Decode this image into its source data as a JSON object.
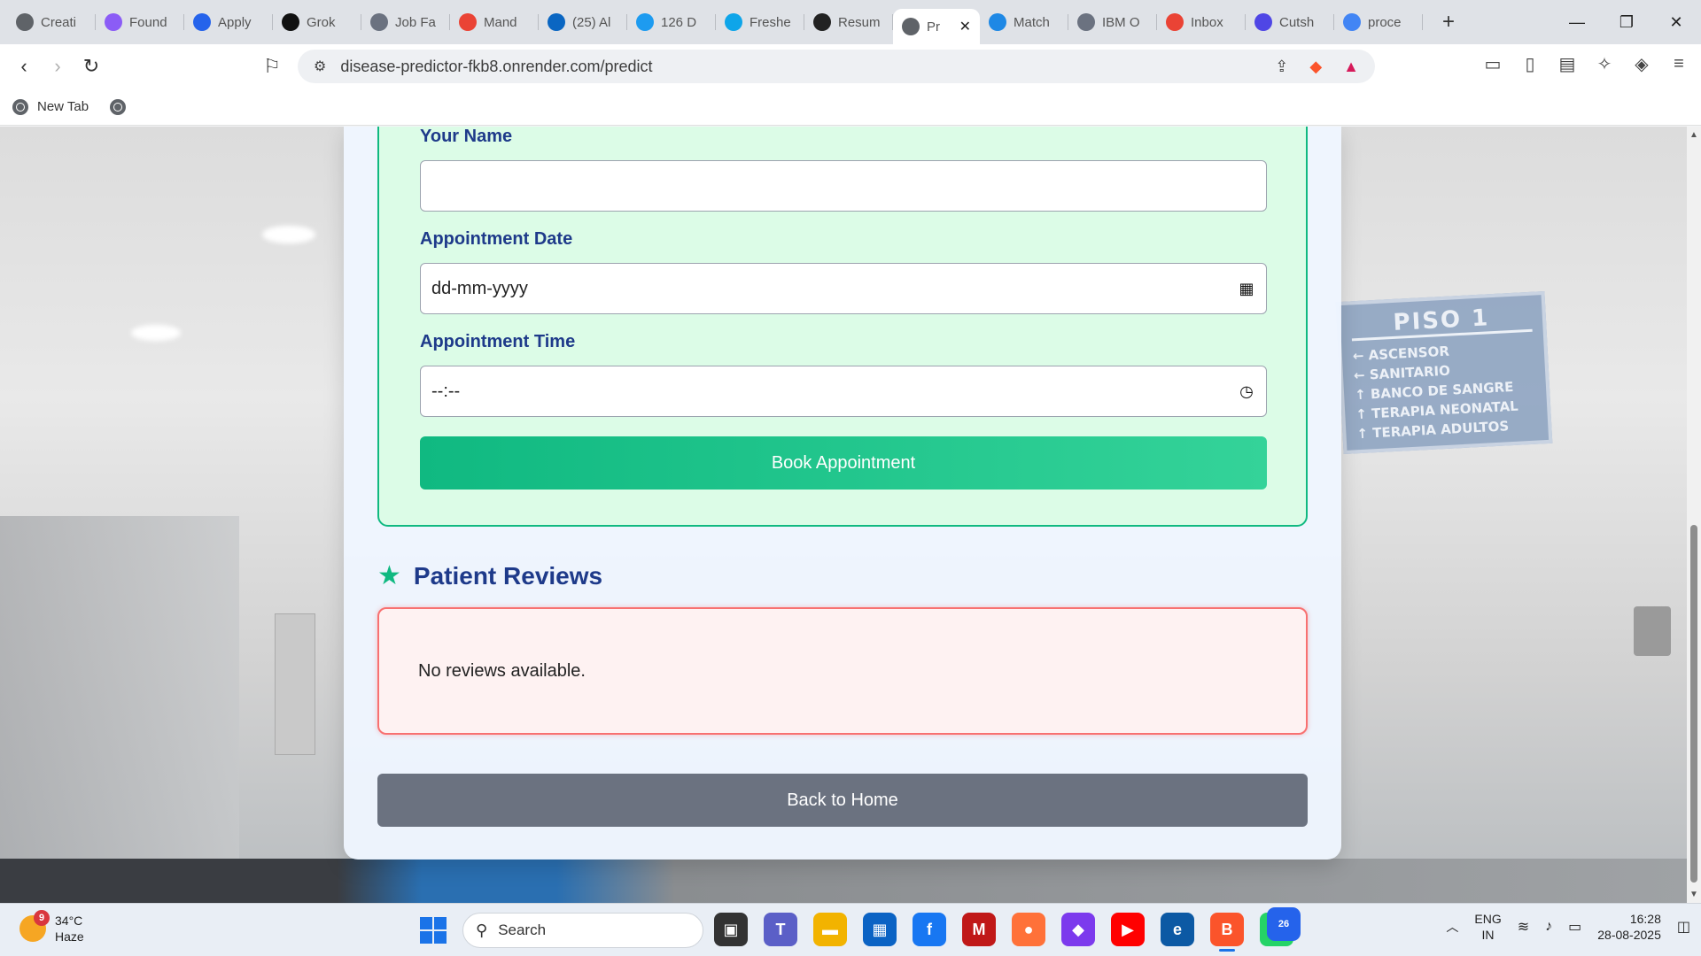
{
  "browser": {
    "tabs": [
      {
        "title": "Creati",
        "icon": "openai-icon",
        "color": "#5f6368"
      },
      {
        "title": "Found",
        "icon": "gemini-icon",
        "color": "#8b5cf6"
      },
      {
        "title": "Apply",
        "icon": "apply-icon",
        "color": "#2563eb"
      },
      {
        "title": "Grok",
        "icon": "grok-icon",
        "color": "#111111"
      },
      {
        "title": "Job Fa",
        "icon": "jobfair-icon",
        "color": "#6b7280"
      },
      {
        "title": "Mand",
        "icon": "gmail-icon",
        "color": "#ea4335"
      },
      {
        "title": "(25) Al",
        "icon": "linkedin-icon",
        "color": "#0a66c2"
      },
      {
        "title": "126 D",
        "icon": "s-icon",
        "color": "#1d9bf0"
      },
      {
        "title": "Freshe",
        "icon": "is-icon",
        "color": "#0ea5e9"
      },
      {
        "title": "Resum",
        "icon": "openai-icon",
        "color": "#222222"
      },
      {
        "title": "Pr",
        "icon": "globe-icon",
        "color": "#5f6368",
        "active": true
      },
      {
        "title": "Match",
        "icon": "match-icon",
        "color": "#1e88e5"
      },
      {
        "title": "IBM O",
        "icon": "ibm-icon",
        "color": "#6b7280"
      },
      {
        "title": "Inbox",
        "icon": "gmail-icon",
        "color": "#ea4335"
      },
      {
        "title": "Cutsh",
        "icon": "cutshort-icon",
        "color": "#4f46e5"
      },
      {
        "title": "proce",
        "icon": "google-icon",
        "color": "#4285f4"
      }
    ],
    "url": "disease-predictor-fkb8.onrender.com/predict",
    "bookmarks": [
      {
        "label": "New Tab"
      }
    ]
  },
  "form": {
    "name_label": "Your Name",
    "name_value": "",
    "date_label": "Appointment Date",
    "date_placeholder": "dd-mm-yyyy",
    "time_label": "Appointment Time",
    "time_placeholder": "--:--",
    "book_button": "Book Appointment"
  },
  "reviews": {
    "heading": "Patient Reviews",
    "empty_text": "No reviews available."
  },
  "home_button": "Back to Home",
  "background_sign": {
    "heading": "PISO 1",
    "lines": [
      "ASCENSOR",
      "SANITARIO",
      "BANCO DE SANGRE",
      "TERAPIA NEONATAL",
      "TERAPIA ADULTOS"
    ]
  },
  "taskbar": {
    "weather_temp": "34°C",
    "weather_desc": "Haze",
    "weather_badge": "9",
    "search_label": "Search",
    "apps": [
      {
        "name": "task-view",
        "color": "#333333",
        "glyph": "▣"
      },
      {
        "name": "teams",
        "color": "#5b5fc7",
        "glyph": "T"
      },
      {
        "name": "file-explorer",
        "color": "#f2b300",
        "glyph": "▬"
      },
      {
        "name": "store",
        "color": "#0b63c4",
        "glyph": "▦"
      },
      {
        "name": "facebook",
        "color": "#1877f2",
        "glyph": "f"
      },
      {
        "name": "mcafee",
        "color": "#c01818",
        "glyph": "M"
      },
      {
        "name": "firefox",
        "color": "#ff7139",
        "glyph": "●"
      },
      {
        "name": "copilot",
        "color": "#7c3aed",
        "glyph": "◆"
      },
      {
        "name": "youtube",
        "color": "#ff0000",
        "glyph": "▶"
      },
      {
        "name": "edge",
        "color": "#0c59a4",
        "glyph": "e"
      },
      {
        "name": "brave",
        "color": "#fb542b",
        "glyph": "B",
        "active": true
      },
      {
        "name": "whatsapp",
        "color": "#25d366",
        "glyph": "✆",
        "count": "26"
      }
    ],
    "lang_line1": "ENG",
    "lang_line2": "IN",
    "time": "16:28",
    "date": "28-08-2025"
  }
}
